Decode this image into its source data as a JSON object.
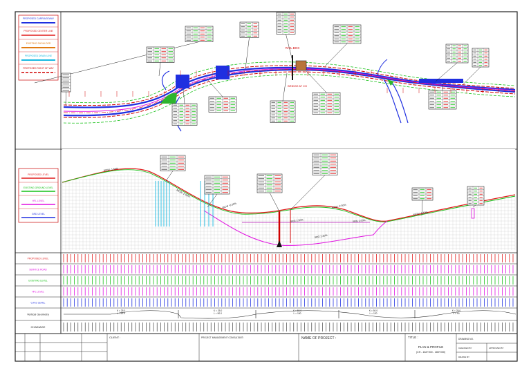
{
  "colors": {
    "carriageway": "#1f2fe0",
    "center_line": "#e01b1b",
    "shoulder": "#e07a10",
    "drain": "#17b8e0",
    "row": "#d00000",
    "green": "#16c016",
    "magenta": "#e010e0",
    "hfl": "#b010b0",
    "grid": "#c8c8c8"
  },
  "plan_legend": [
    "PROPOSED CARRIAGEWAY",
    "PROPOSED CENTER LINE",
    "EXISTING SHOULDER",
    "PROPOSED DRAIN LINE",
    "PROPOSED RIGHT OF WAY"
  ],
  "profile_legend": [
    "PROPOSED LEVEL",
    "EXISTING GROUND LEVEL",
    "HFL LEVEL",
    "GRD LEVEL"
  ],
  "plan_callouts": {
    "rail_box": "RAIL BOX",
    "bridge": "BRIDGE AT CH"
  },
  "profile_annotations": {
    "grade_1": "MCW -1.50%",
    "grade_2": "MCW -2.00%",
    "grade_3": "MCW -0.50%",
    "grade_4": "MCW -2.50%",
    "grade_5": "MCW -0.50%",
    "grade_6": "SRG 2.20%",
    "grade_7": "SRG 2.50%",
    "grade_8": "SRG 1.00%"
  },
  "band_rows": [
    "PROPOSED LEVEL",
    "SERVICE ROAD",
    "EXISTING LEVEL",
    "HFL LEVEL",
    "G.R.D LEVEL",
    "Vertical Geometry",
    "CHAINAGE"
  ],
  "vertical_curves": [
    "K = 25.0  L = 60.0",
    "K = 25.0  L = 90.0",
    "K = 50.0  L = 150",
    "K = 50.0  L = 120",
    "K = 25.0  L = 90"
  ],
  "title_block": {
    "client": "CLIENT :",
    "consultant": "PROJECT MANAGEMENT CONSULTANT :",
    "project": "NAME OF PROJECT :",
    "title_label": "TITLE :",
    "title_line1": "PLAN & PROFILE",
    "title_line2": "(CH - 184+000 - 185+000)",
    "drawing_no": "DRAWING NO.",
    "checked": "CHECKED BY",
    "drawn": "DRAWN BY",
    "approved": "APPROVED BY"
  }
}
